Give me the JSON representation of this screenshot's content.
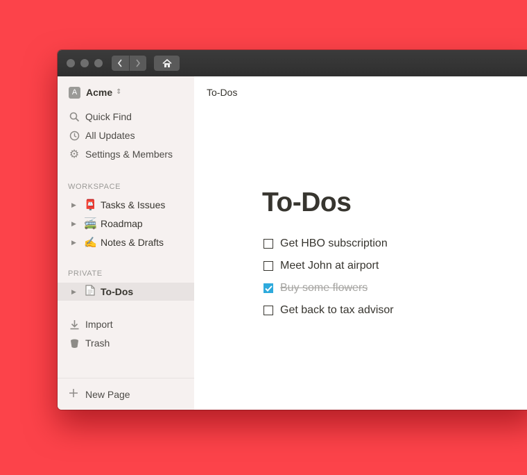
{
  "workspace": {
    "initial": "A",
    "name": "Acme"
  },
  "nav": {
    "quick_find": "Quick Find",
    "all_updates": "All Updates",
    "settings": "Settings & Members"
  },
  "sections": {
    "workspace": "WORKSPACE",
    "private": "PRIVATE"
  },
  "workspace_pages": [
    {
      "emoji": "📮",
      "label": "Tasks & Issues"
    },
    {
      "emoji": "🚎",
      "label": "Roadmap"
    },
    {
      "emoji": "✍️",
      "label": "Notes & Drafts"
    }
  ],
  "private_pages": [
    {
      "emoji": "📄",
      "label": "To-Dos"
    }
  ],
  "footer_nav": {
    "import": "Import",
    "trash": "Trash"
  },
  "new_page": "New Page",
  "page": {
    "breadcrumb": "To-Dos",
    "title": "To-Dos",
    "todos": [
      {
        "text": "Get HBO subscription",
        "checked": false
      },
      {
        "text": "Meet John at airport",
        "checked": false
      },
      {
        "text": "Buy some flowers",
        "checked": true
      },
      {
        "text": "Get back to tax advisor",
        "checked": false
      }
    ]
  },
  "colors": {
    "background": "#fc434a",
    "titlebar": "#333333",
    "sidebar": "#f6f1f0",
    "checkbox_checked": "#2eaadc"
  }
}
